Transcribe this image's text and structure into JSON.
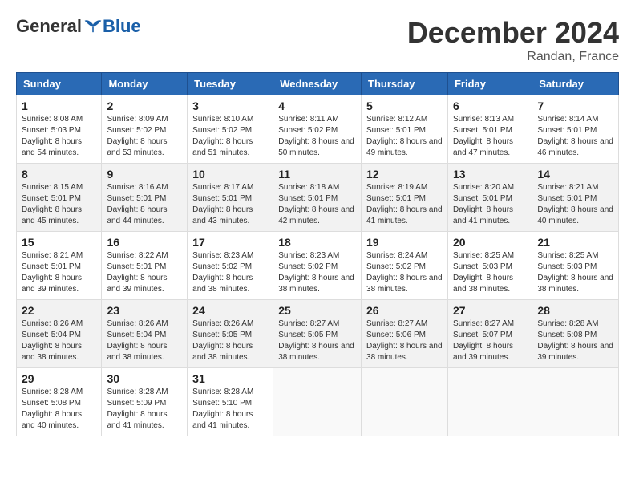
{
  "header": {
    "logo_general": "General",
    "logo_blue": "Blue",
    "title": "December 2024",
    "subtitle": "Randan, France"
  },
  "days_of_week": [
    "Sunday",
    "Monday",
    "Tuesday",
    "Wednesday",
    "Thursday",
    "Friday",
    "Saturday"
  ],
  "weeks": [
    [
      {
        "day": "1",
        "sunrise": "Sunrise: 8:08 AM",
        "sunset": "Sunset: 5:03 PM",
        "daylight": "Daylight: 8 hours and 54 minutes."
      },
      {
        "day": "2",
        "sunrise": "Sunrise: 8:09 AM",
        "sunset": "Sunset: 5:02 PM",
        "daylight": "Daylight: 8 hours and 53 minutes."
      },
      {
        "day": "3",
        "sunrise": "Sunrise: 8:10 AM",
        "sunset": "Sunset: 5:02 PM",
        "daylight": "Daylight: 8 hours and 51 minutes."
      },
      {
        "day": "4",
        "sunrise": "Sunrise: 8:11 AM",
        "sunset": "Sunset: 5:02 PM",
        "daylight": "Daylight: 8 hours and 50 minutes."
      },
      {
        "day": "5",
        "sunrise": "Sunrise: 8:12 AM",
        "sunset": "Sunset: 5:01 PM",
        "daylight": "Daylight: 8 hours and 49 minutes."
      },
      {
        "day": "6",
        "sunrise": "Sunrise: 8:13 AM",
        "sunset": "Sunset: 5:01 PM",
        "daylight": "Daylight: 8 hours and 47 minutes."
      },
      {
        "day": "7",
        "sunrise": "Sunrise: 8:14 AM",
        "sunset": "Sunset: 5:01 PM",
        "daylight": "Daylight: 8 hours and 46 minutes."
      }
    ],
    [
      {
        "day": "8",
        "sunrise": "Sunrise: 8:15 AM",
        "sunset": "Sunset: 5:01 PM",
        "daylight": "Daylight: 8 hours and 45 minutes."
      },
      {
        "day": "9",
        "sunrise": "Sunrise: 8:16 AM",
        "sunset": "Sunset: 5:01 PM",
        "daylight": "Daylight: 8 hours and 44 minutes."
      },
      {
        "day": "10",
        "sunrise": "Sunrise: 8:17 AM",
        "sunset": "Sunset: 5:01 PM",
        "daylight": "Daylight: 8 hours and 43 minutes."
      },
      {
        "day": "11",
        "sunrise": "Sunrise: 8:18 AM",
        "sunset": "Sunset: 5:01 PM",
        "daylight": "Daylight: 8 hours and 42 minutes."
      },
      {
        "day": "12",
        "sunrise": "Sunrise: 8:19 AM",
        "sunset": "Sunset: 5:01 PM",
        "daylight": "Daylight: 8 hours and 41 minutes."
      },
      {
        "day": "13",
        "sunrise": "Sunrise: 8:20 AM",
        "sunset": "Sunset: 5:01 PM",
        "daylight": "Daylight: 8 hours and 41 minutes."
      },
      {
        "day": "14",
        "sunrise": "Sunrise: 8:21 AM",
        "sunset": "Sunset: 5:01 PM",
        "daylight": "Daylight: 8 hours and 40 minutes."
      }
    ],
    [
      {
        "day": "15",
        "sunrise": "Sunrise: 8:21 AM",
        "sunset": "Sunset: 5:01 PM",
        "daylight": "Daylight: 8 hours and 39 minutes."
      },
      {
        "day": "16",
        "sunrise": "Sunrise: 8:22 AM",
        "sunset": "Sunset: 5:01 PM",
        "daylight": "Daylight: 8 hours and 39 minutes."
      },
      {
        "day": "17",
        "sunrise": "Sunrise: 8:23 AM",
        "sunset": "Sunset: 5:02 PM",
        "daylight": "Daylight: 8 hours and 38 minutes."
      },
      {
        "day": "18",
        "sunrise": "Sunrise: 8:23 AM",
        "sunset": "Sunset: 5:02 PM",
        "daylight": "Daylight: 8 hours and 38 minutes."
      },
      {
        "day": "19",
        "sunrise": "Sunrise: 8:24 AM",
        "sunset": "Sunset: 5:02 PM",
        "daylight": "Daylight: 8 hours and 38 minutes."
      },
      {
        "day": "20",
        "sunrise": "Sunrise: 8:25 AM",
        "sunset": "Sunset: 5:03 PM",
        "daylight": "Daylight: 8 hours and 38 minutes."
      },
      {
        "day": "21",
        "sunrise": "Sunrise: 8:25 AM",
        "sunset": "Sunset: 5:03 PM",
        "daylight": "Daylight: 8 hours and 38 minutes."
      }
    ],
    [
      {
        "day": "22",
        "sunrise": "Sunrise: 8:26 AM",
        "sunset": "Sunset: 5:04 PM",
        "daylight": "Daylight: 8 hours and 38 minutes."
      },
      {
        "day": "23",
        "sunrise": "Sunrise: 8:26 AM",
        "sunset": "Sunset: 5:04 PM",
        "daylight": "Daylight: 8 hours and 38 minutes."
      },
      {
        "day": "24",
        "sunrise": "Sunrise: 8:26 AM",
        "sunset": "Sunset: 5:05 PM",
        "daylight": "Daylight: 8 hours and 38 minutes."
      },
      {
        "day": "25",
        "sunrise": "Sunrise: 8:27 AM",
        "sunset": "Sunset: 5:05 PM",
        "daylight": "Daylight: 8 hours and 38 minutes."
      },
      {
        "day": "26",
        "sunrise": "Sunrise: 8:27 AM",
        "sunset": "Sunset: 5:06 PM",
        "daylight": "Daylight: 8 hours and 38 minutes."
      },
      {
        "day": "27",
        "sunrise": "Sunrise: 8:27 AM",
        "sunset": "Sunset: 5:07 PM",
        "daylight": "Daylight: 8 hours and 39 minutes."
      },
      {
        "day": "28",
        "sunrise": "Sunrise: 8:28 AM",
        "sunset": "Sunset: 5:08 PM",
        "daylight": "Daylight: 8 hours and 39 minutes."
      }
    ],
    [
      {
        "day": "29",
        "sunrise": "Sunrise: 8:28 AM",
        "sunset": "Sunset: 5:08 PM",
        "daylight": "Daylight: 8 hours and 40 minutes."
      },
      {
        "day": "30",
        "sunrise": "Sunrise: 8:28 AM",
        "sunset": "Sunset: 5:09 PM",
        "daylight": "Daylight: 8 hours and 41 minutes."
      },
      {
        "day": "31",
        "sunrise": "Sunrise: 8:28 AM",
        "sunset": "Sunset: 5:10 PM",
        "daylight": "Daylight: 8 hours and 41 minutes."
      },
      null,
      null,
      null,
      null
    ]
  ]
}
